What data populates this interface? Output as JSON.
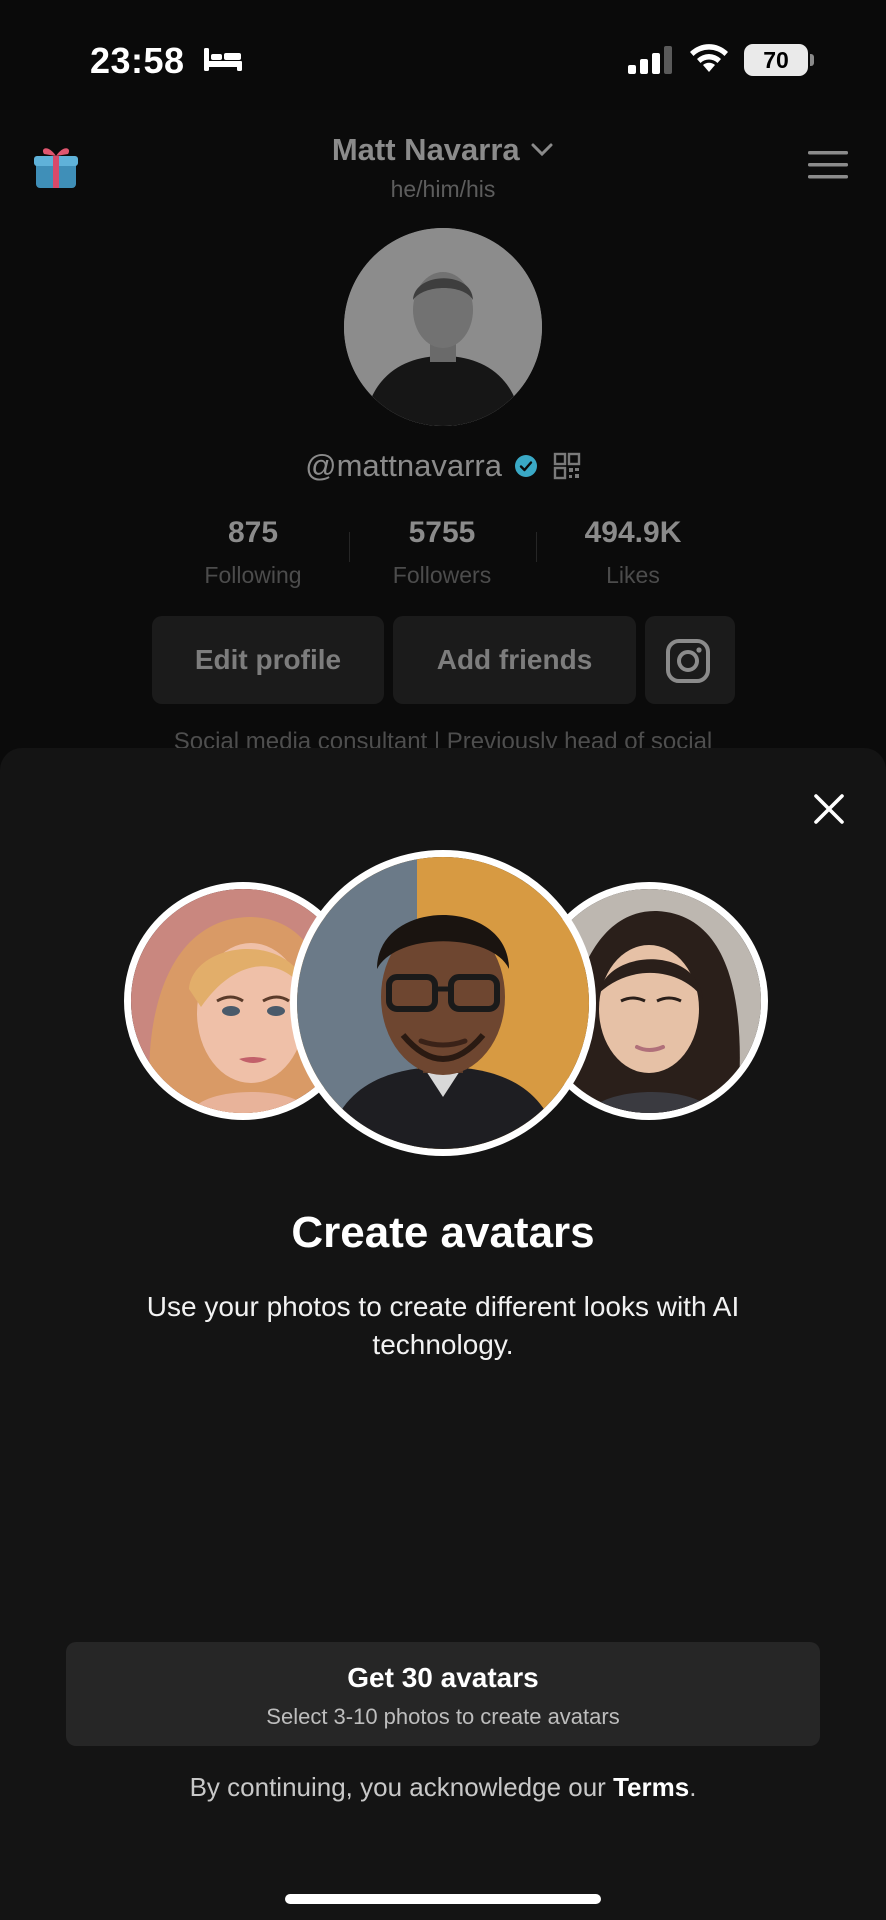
{
  "status_bar": {
    "time": "23:58",
    "battery": "70"
  },
  "profile": {
    "name": "Matt Navarra",
    "pronouns": "he/him/his",
    "username": "@mattnavarra",
    "stats": [
      {
        "value": "875",
        "label": "Following"
      },
      {
        "value": "5755",
        "label": "Followers"
      },
      {
        "value": "494.9K",
        "label": "Likes"
      }
    ],
    "buttons": {
      "edit_profile": "Edit profile",
      "add_friends": "Add friends"
    },
    "bio": "Social media consultant | Previously head of social"
  },
  "sheet": {
    "title": "Create avatars",
    "description": "Use your photos to create different looks with AI technology.",
    "cta_label": "Get 30 avatars",
    "cta_subtext": "Select 3-10 photos to create avatars",
    "terms_prefix": "By continuing, you acknowledge our ",
    "terms_link": "Terms",
    "terms_suffix": "."
  },
  "icons": [
    "bed-icon",
    "signal-icon",
    "wifi-icon",
    "gift-icon",
    "chevron-down-icon",
    "menu-icon",
    "verified-icon",
    "qr-icon",
    "instagram-icon",
    "close-icon"
  ],
  "colors": {
    "background": "#0a0a0a",
    "sheet": "#141414",
    "button": "#262626",
    "verified": "#3aa9c6"
  }
}
